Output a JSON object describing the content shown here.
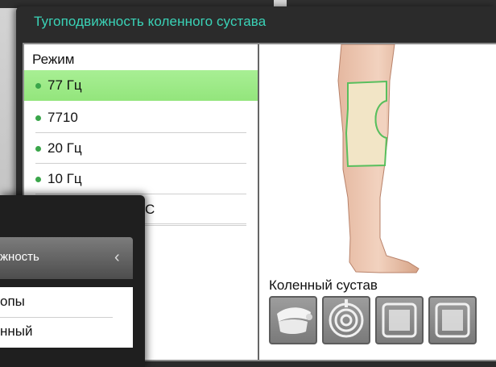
{
  "dialog": {
    "title": "Тугоподвижность коленного сустава"
  },
  "mode_list": {
    "header": "Режим",
    "items": [
      {
        "label": "77 Гц",
        "active": true
      },
      {
        "label": "7710",
        "active": false
      },
      {
        "label": "20 Гц",
        "active": false
      },
      {
        "label": "10 Гц",
        "active": false
      },
      {
        "label": "С",
        "active": false
      }
    ]
  },
  "body_zone": {
    "label": "Коленный сустав",
    "image": "knee-leg-with-support-wrap",
    "electrodes": [
      "handheld-roller-electrode-icon",
      "round-spiral-electrode-icon",
      "square-pad-electrode-icon",
      "square-pad-electrode-icon"
    ]
  },
  "side_menu": {
    "header": "жность",
    "items": [
      "опы",
      "нный"
    ]
  },
  "colors": {
    "accent_teal": "#3ad3b7",
    "active_item_green": "#9be883",
    "dot_green": "#3aa64a",
    "dialog_dark": "#2b2b2b"
  }
}
